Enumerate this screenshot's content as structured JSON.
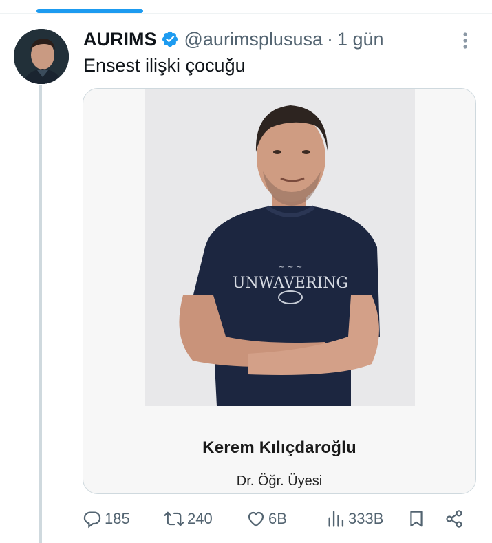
{
  "tweet": {
    "author": {
      "display_name": "AURIMS",
      "handle": "@aurimsplususa",
      "verified": true
    },
    "separator": "·",
    "time": "1 gün",
    "text": "Ensest ilişki çocuğu",
    "media": {
      "shirt_text": "UNWAVERING",
      "caption_name": "Kerem Kılıçdaroğlu",
      "caption_title": "Dr. Öğr. Üyesi"
    },
    "actions": {
      "replies": "185",
      "retweets": "240",
      "likes": "6B",
      "views": "333B"
    }
  },
  "colors": {
    "accent": "#1d9bf0",
    "secondary_text": "#536471",
    "primary_text": "#0f1419",
    "thread_line": "#cfd9de"
  },
  "icons": {
    "verified": "verified-badge-icon",
    "more": "more-vertical-icon",
    "reply": "reply-icon",
    "retweet": "retweet-icon",
    "like": "heart-icon",
    "views": "views-chart-icon",
    "bookmark": "bookmark-icon",
    "share": "share-icon"
  }
}
